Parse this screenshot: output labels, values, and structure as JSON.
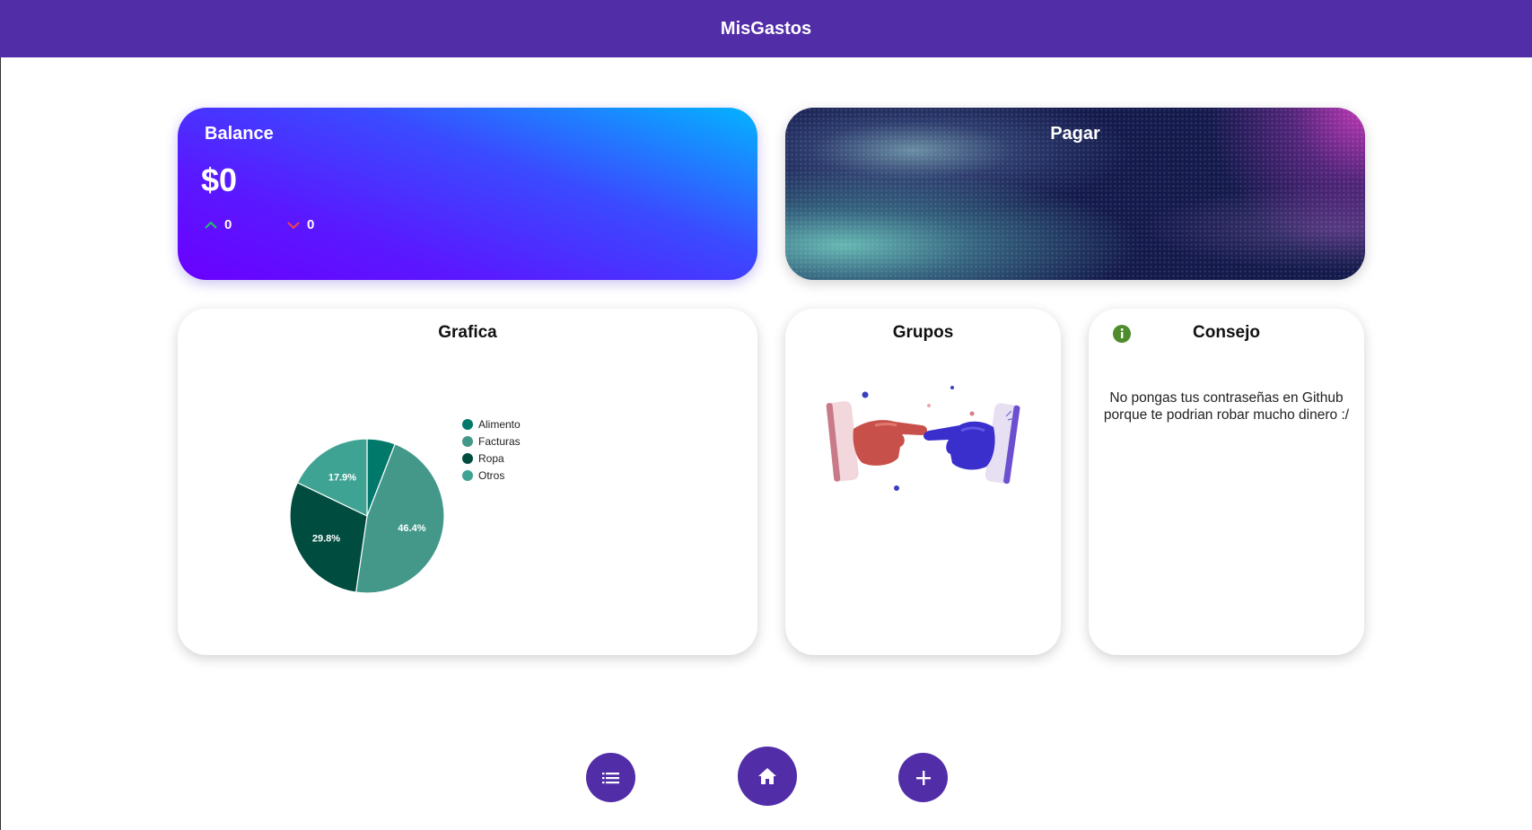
{
  "app": {
    "title": "MisGastos"
  },
  "balance": {
    "label": "Balance",
    "amount": "$0",
    "income": "0",
    "expense": "0"
  },
  "pay": {
    "label": "Pagar"
  },
  "chart_card": {
    "title": "Grafica"
  },
  "groups": {
    "title": "Grupos"
  },
  "tip": {
    "title": "Consejo",
    "text": "No pongas tus contraseñas en Github porque te podrian robar mucho dinero :/"
  },
  "colors": {
    "header": "#512DA8",
    "income_arrow": "#22c55e",
    "expense_arrow": "#ef4444",
    "info_icon": "#4e8c2e"
  },
  "icons": {
    "list": "list-icon",
    "home": "home-icon",
    "add": "plus-icon",
    "info": "info-icon"
  },
  "chart_data": {
    "type": "pie",
    "title": "",
    "categories": [
      "Alimento",
      "Facturas",
      "Ropa",
      "Otros"
    ],
    "values": [
      5.9,
      46.4,
      29.8,
      17.9
    ],
    "labels": [
      "",
      "46.4%",
      "29.8%",
      "17.9%"
    ],
    "colors": [
      "#00796B",
      "#43988A",
      "#004D40",
      "#3FA394"
    ],
    "legend": "right"
  }
}
